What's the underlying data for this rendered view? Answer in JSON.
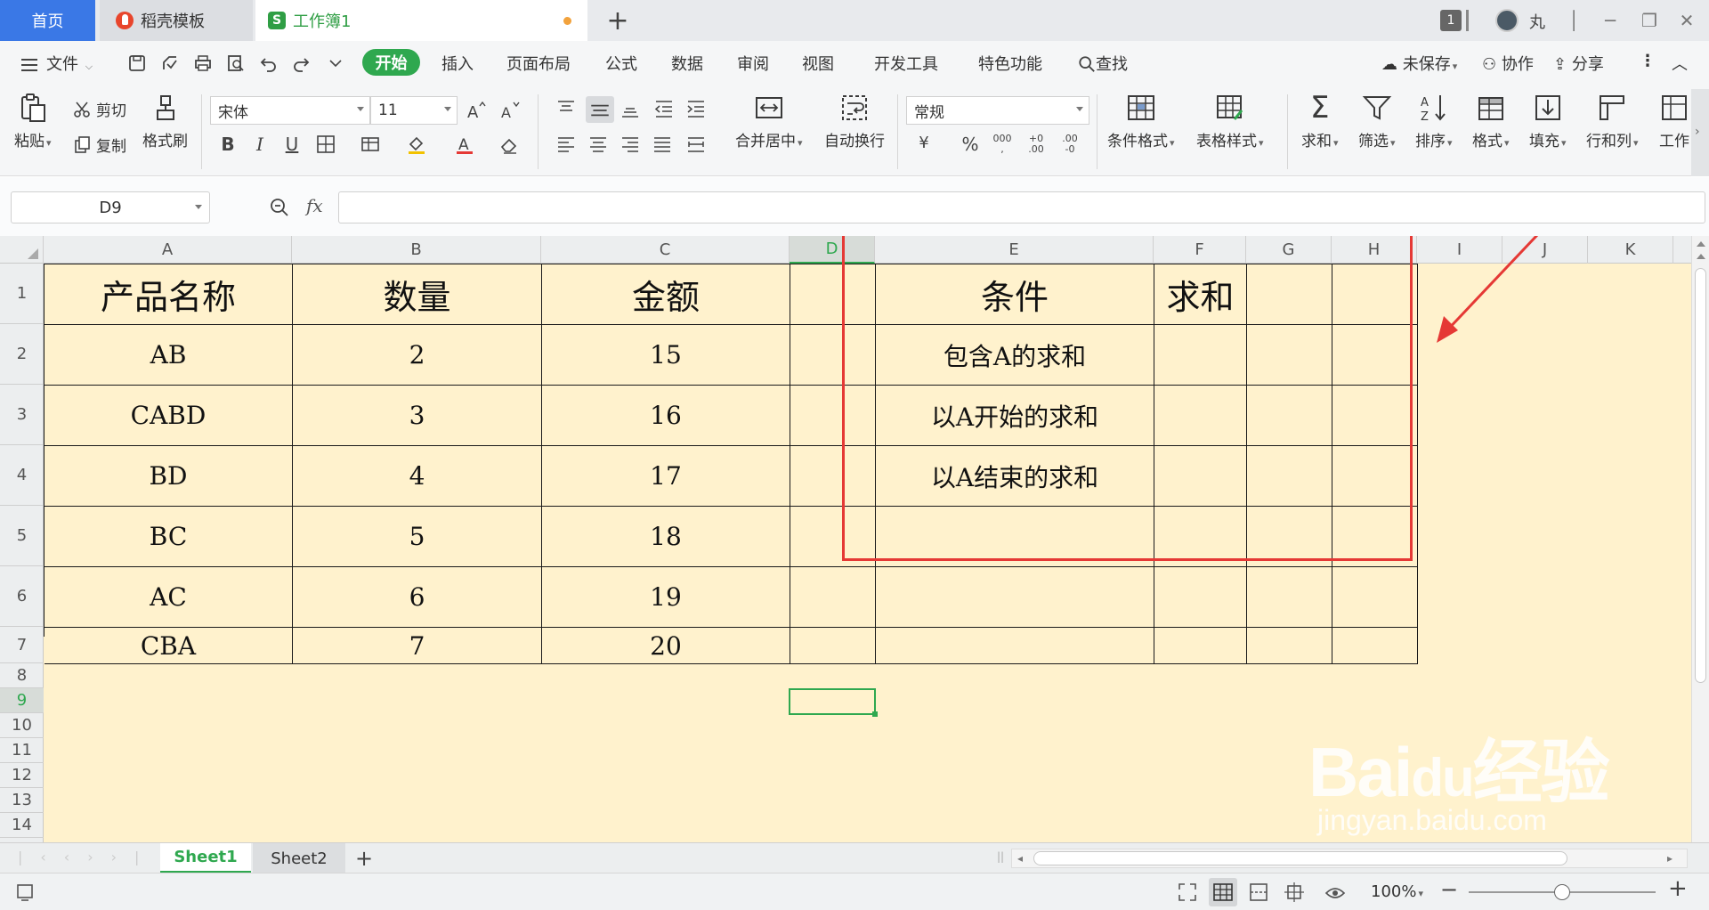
{
  "titlebar": {
    "tabs": [
      {
        "label": "首页"
      },
      {
        "label": "稻壳模板"
      },
      {
        "label": "工作簿1"
      }
    ],
    "badge_count": "1",
    "username": "丸"
  },
  "menubar": {
    "file_label": "文件",
    "items": [
      "开始",
      "插入",
      "页面布局",
      "公式",
      "数据",
      "审阅",
      "视图",
      "开发工具",
      "特色功能"
    ],
    "search_label": "查找",
    "unsaved_label": "未保存",
    "collab_label": "协作",
    "share_label": "分享"
  },
  "ribbon": {
    "paste_label": "粘贴",
    "cut_label": "剪切",
    "copy_label": "复制",
    "format_painter_label": "格式刷",
    "font_name": "宋体",
    "font_size": "11",
    "merge_center_label": "合并居中",
    "wrap_text_label": "自动换行",
    "number_format": "常规",
    "conditional_format_label": "条件格式",
    "table_style_label": "表格样式",
    "sum_label": "求和",
    "filter_label": "筛选",
    "sort_label": "排序",
    "format_label": "格式",
    "fill_label": "填充",
    "rowcol_label": "行和列",
    "worksheet_label": "工作"
  },
  "formula_bar": {
    "name_box": "D9",
    "fx_label": "fx",
    "formula": ""
  },
  "columns": [
    "A",
    "B",
    "C",
    "D",
    "E",
    "F",
    "G",
    "H",
    "I",
    "J",
    "K"
  ],
  "rows": [
    "1",
    "2",
    "3",
    "4",
    "5",
    "6",
    "7",
    "8",
    "9",
    "10",
    "11",
    "12",
    "13",
    "14"
  ],
  "table": {
    "headers": [
      "产品名称",
      "数量",
      "金额",
      "",
      "条件",
      "求和"
    ],
    "data": [
      [
        "AB",
        "2",
        "15",
        "",
        "包含A的求和"
      ],
      [
        "CABD",
        "3",
        "16",
        "",
        "以A开始的求和"
      ],
      [
        "BD",
        "4",
        "17",
        "",
        "以A结束的求和"
      ],
      [
        "BC",
        "5",
        "18",
        "",
        ""
      ],
      [
        "AC",
        "6",
        "19",
        "",
        ""
      ],
      [
        "CBA",
        "7",
        "20",
        "",
        ""
      ]
    ]
  },
  "selected_cell": "D9",
  "annotation_color": "#e53935",
  "sheets": [
    "Sheet1",
    "Sheet2"
  ],
  "active_sheet": "Sheet1",
  "status": {
    "zoom": "100%"
  },
  "watermark": "Baidu经验 jingyan.baidu.com",
  "colors": {
    "accent_green": "#2fa84f",
    "home_tab_blue": "#3a78e6",
    "cell_fill": "#fff2cd"
  }
}
